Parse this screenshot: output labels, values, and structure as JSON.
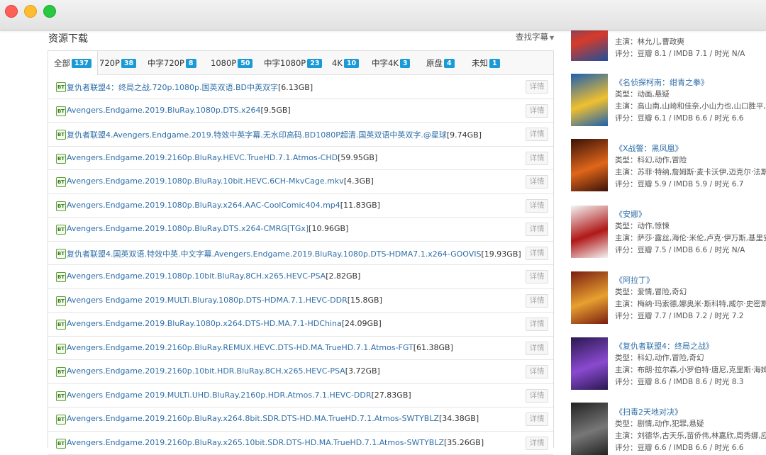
{
  "section_title": "资源下载",
  "find_subtitle": "查找字幕",
  "tabs": [
    {
      "label": "全部",
      "count": "137"
    },
    {
      "label": "720P",
      "count": "38"
    },
    {
      "label": "中字720P",
      "count": "8"
    },
    {
      "label": "1080P",
      "count": "50"
    },
    {
      "label": "中字1080P",
      "count": "23"
    },
    {
      "label": "4K",
      "count": "10"
    },
    {
      "label": "中字4K",
      "count": "3"
    },
    {
      "label": "原盘",
      "count": "4"
    },
    {
      "label": "未知",
      "count": "1"
    }
  ],
  "detail_label": "详情",
  "resources": [
    {
      "name": "复仇者联盟4：终局之战.720p.1080p.国英双语.BD中英双字",
      "size": "[6.13GB]"
    },
    {
      "name": "Avengers.Endgame.2019.BluRay.1080p.DTS.x264",
      "size": "[9.5GB]"
    },
    {
      "name": "复仇者联盟4.Avengers.Endgame.2019.特效中英字幕.无水印高码.BD1080P超清.国英双语中英双字.@星球",
      "size": "[9.74GB]"
    },
    {
      "name": "Avengers.Endgame.2019.2160p.BluRay.HEVC.TrueHD.7.1.Atmos-CHD",
      "size": "[59.95GB]"
    },
    {
      "name": "Avengers.Endgame.2019.1080p.BluRay.10bit.HEVC.6CH-MkvCage.mkv",
      "size": "[4.3GB]"
    },
    {
      "name": "Avengers.Endgame.2019.1080p.BluRay.x264.AAC-CoolComic404.mp4",
      "size": "[11.83GB]"
    },
    {
      "name": "Avengers.Endgame.2019.1080p.BluRay.DTS.x264-CMRG[TGx]",
      "size": "[10.96GB]"
    },
    {
      "name": "复仇者联盟4.国英双语.特效中英.中文字幕.Avengers.Endgame.2019.BluRay.1080p.DTS-HDMA7.1.x264-GOOVIS",
      "size": "[19.93GB]"
    },
    {
      "name": "Avengers.Endgame.2019.1080p.10bit.BluRay.8CH.x265.HEVC-PSA",
      "size": "[2.82GB]"
    },
    {
      "name": "Avengers Endgame 2019.MULTi.Bluray.1080p.DTS-HDMA.7.1.HEVC-DDR",
      "size": "[15.8GB]"
    },
    {
      "name": "Avengers.Endgame.2019.BluRay.1080p.x264.DTS-HD.MA.7.1-HDChina",
      "size": "[24.09GB]"
    },
    {
      "name": "Avengers.Endgame.2019.2160p.BluRay.REMUX.HEVC.DTS-HD.MA.TrueHD.7.1.Atmos-FGT",
      "size": "[61.38GB]"
    },
    {
      "name": "Avengers.Endgame.2019.2160p.10bit.HDR.BluRay.8CH.x265.HEVC-PSA",
      "size": "[3.72GB]"
    },
    {
      "name": "Avengers Endgame 2019.MULTi.UHD.BluRay.2160p.HDR.Atmos.7.1.HEVC-DDR",
      "size": "[27.83GB]"
    },
    {
      "name": "Avengers.Endgame.2019.2160p.BluRay.x264.8bit.SDR.DTS-HD.MA.TrueHD.7.1.Atmos-SWTYBLZ",
      "size": "[34.38GB]"
    },
    {
      "name": "Avengers.Endgame.2019.2160p.BluRay.x265.10bit.SDR.DTS-HD.MA.TrueHD.7.1.Atmos-SWTYBLZ",
      "size": "[35.26GB]"
    }
  ],
  "sidebar": [
    {
      "title": "",
      "genre": "",
      "cast": "主演：林允儿,曹政奭",
      "rating": "评分：豆瓣 8.1 / IMDB 7.1 / 时光 N/A",
      "colors": [
        "#1f4f9a",
        "#d83a2a"
      ]
    },
    {
      "title": "《名侦探柯南：绀青之拳》",
      "genre": "类型：动画,悬疑",
      "cast": "主演：高山南,山崎和佳奈,小山力也,山口胜平,...",
      "rating": "评分：豆瓣 6.1 / IMDB 6.6 / 时光 6.6",
      "colors": [
        "#1c5fb0",
        "#f0c030"
      ]
    },
    {
      "title": "《X战警：黑凤凰》",
      "genre": "类型：科幻,动作,冒险",
      "cast": "主演：苏菲·特纳,詹姆斯·麦卡沃伊,迈克尔·法斯...",
      "rating": "评分：豆瓣 5.9 / IMDB 5.9 / 时光 6.7",
      "colors": [
        "#3a1208",
        "#e0661a"
      ]
    },
    {
      "title": "《安娜》",
      "genre": "类型：动作,惊悚",
      "cast": "主演：萨莎·露丝,海伦·米伦,卢克·伊万斯,基里安·...",
      "rating": "评分：豆瓣 7.5 / IMDB 6.6 / 时光 N/A",
      "colors": [
        "#f4f4f4",
        "#b01818"
      ]
    },
    {
      "title": "《阿拉丁》",
      "genre": "类型：爱情,冒险,奇幻",
      "cast": "主演：梅纳·玛索德,娜奥米·斯科特,威尔·史密斯,...",
      "rating": "评分：豆瓣 7.7 / IMDB 7.2 / 时光 7.2",
      "colors": [
        "#7a1e10",
        "#e8a030"
      ]
    },
    {
      "title": "《复仇者联盟4：终局之战》",
      "genre": "类型：科幻,动作,冒险,奇幻",
      "cast": "主演：布朗·拉尔森,小罗伯特·唐尼,克里斯·海姆...",
      "rating": "评分：豆瓣 8.6 / IMDB 8.6 / 时光 8.3",
      "colors": [
        "#2a1850",
        "#8a4ad0"
      ]
    },
    {
      "title": "《扫毒2天地对决》",
      "genre": "类型：剧情,动作,犯罪,悬疑",
      "cast": "主演：刘德华,古天乐,苗侨伟,林嘉欣,周秀娜,应...",
      "rating": "评分：豆瓣 6.6 / IMDB 6.6 / 时光 6.6",
      "colors": [
        "#222222",
        "#777777"
      ]
    }
  ]
}
